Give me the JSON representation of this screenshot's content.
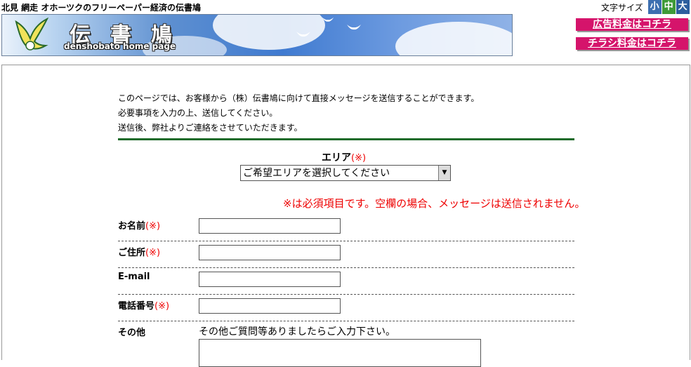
{
  "header": {
    "tagline": "北見 網走 オホーツクのフリーペーパー経済の伝書鳩",
    "brand_kanji": [
      "伝",
      "書",
      "鳩"
    ],
    "brand_english": "denshobato home page"
  },
  "font_size": {
    "label": "文字サイズ",
    "small": "小",
    "medium": "中",
    "large": "大"
  },
  "links": {
    "ad_rates": "広告料金はコチラ",
    "flyer_rates": "チラシ料金はコチラ"
  },
  "intro": {
    "line1": "このページでは、お客様から（株）伝書鳩に向けて直接メッセージを送信することができます。",
    "line2": "必要事項を入力の上、送信してください。",
    "line3": "送信後、弊社よりご連絡をさせていただきます。"
  },
  "area": {
    "label": "エリア",
    "required_mark": "(※)",
    "selected": "ご希望エリアを選択してください"
  },
  "required_note": "※は必須項目です。空欄の場合、メッセージは送信されません。",
  "form": {
    "name_label": "お名前",
    "name_req": "(※)",
    "address_label": "ご住所",
    "address_req": "(※)",
    "email_label": "E-mail",
    "phone_label": "電話番号",
    "phone_req": "(※)",
    "other_label": "その他",
    "other_hint": "その他ご質問等ありましたらご入力下さい。"
  },
  "colors": {
    "accent_pink": "#d5146b",
    "rule_green": "#1f6b2a",
    "required_red": "#ee0000"
  }
}
